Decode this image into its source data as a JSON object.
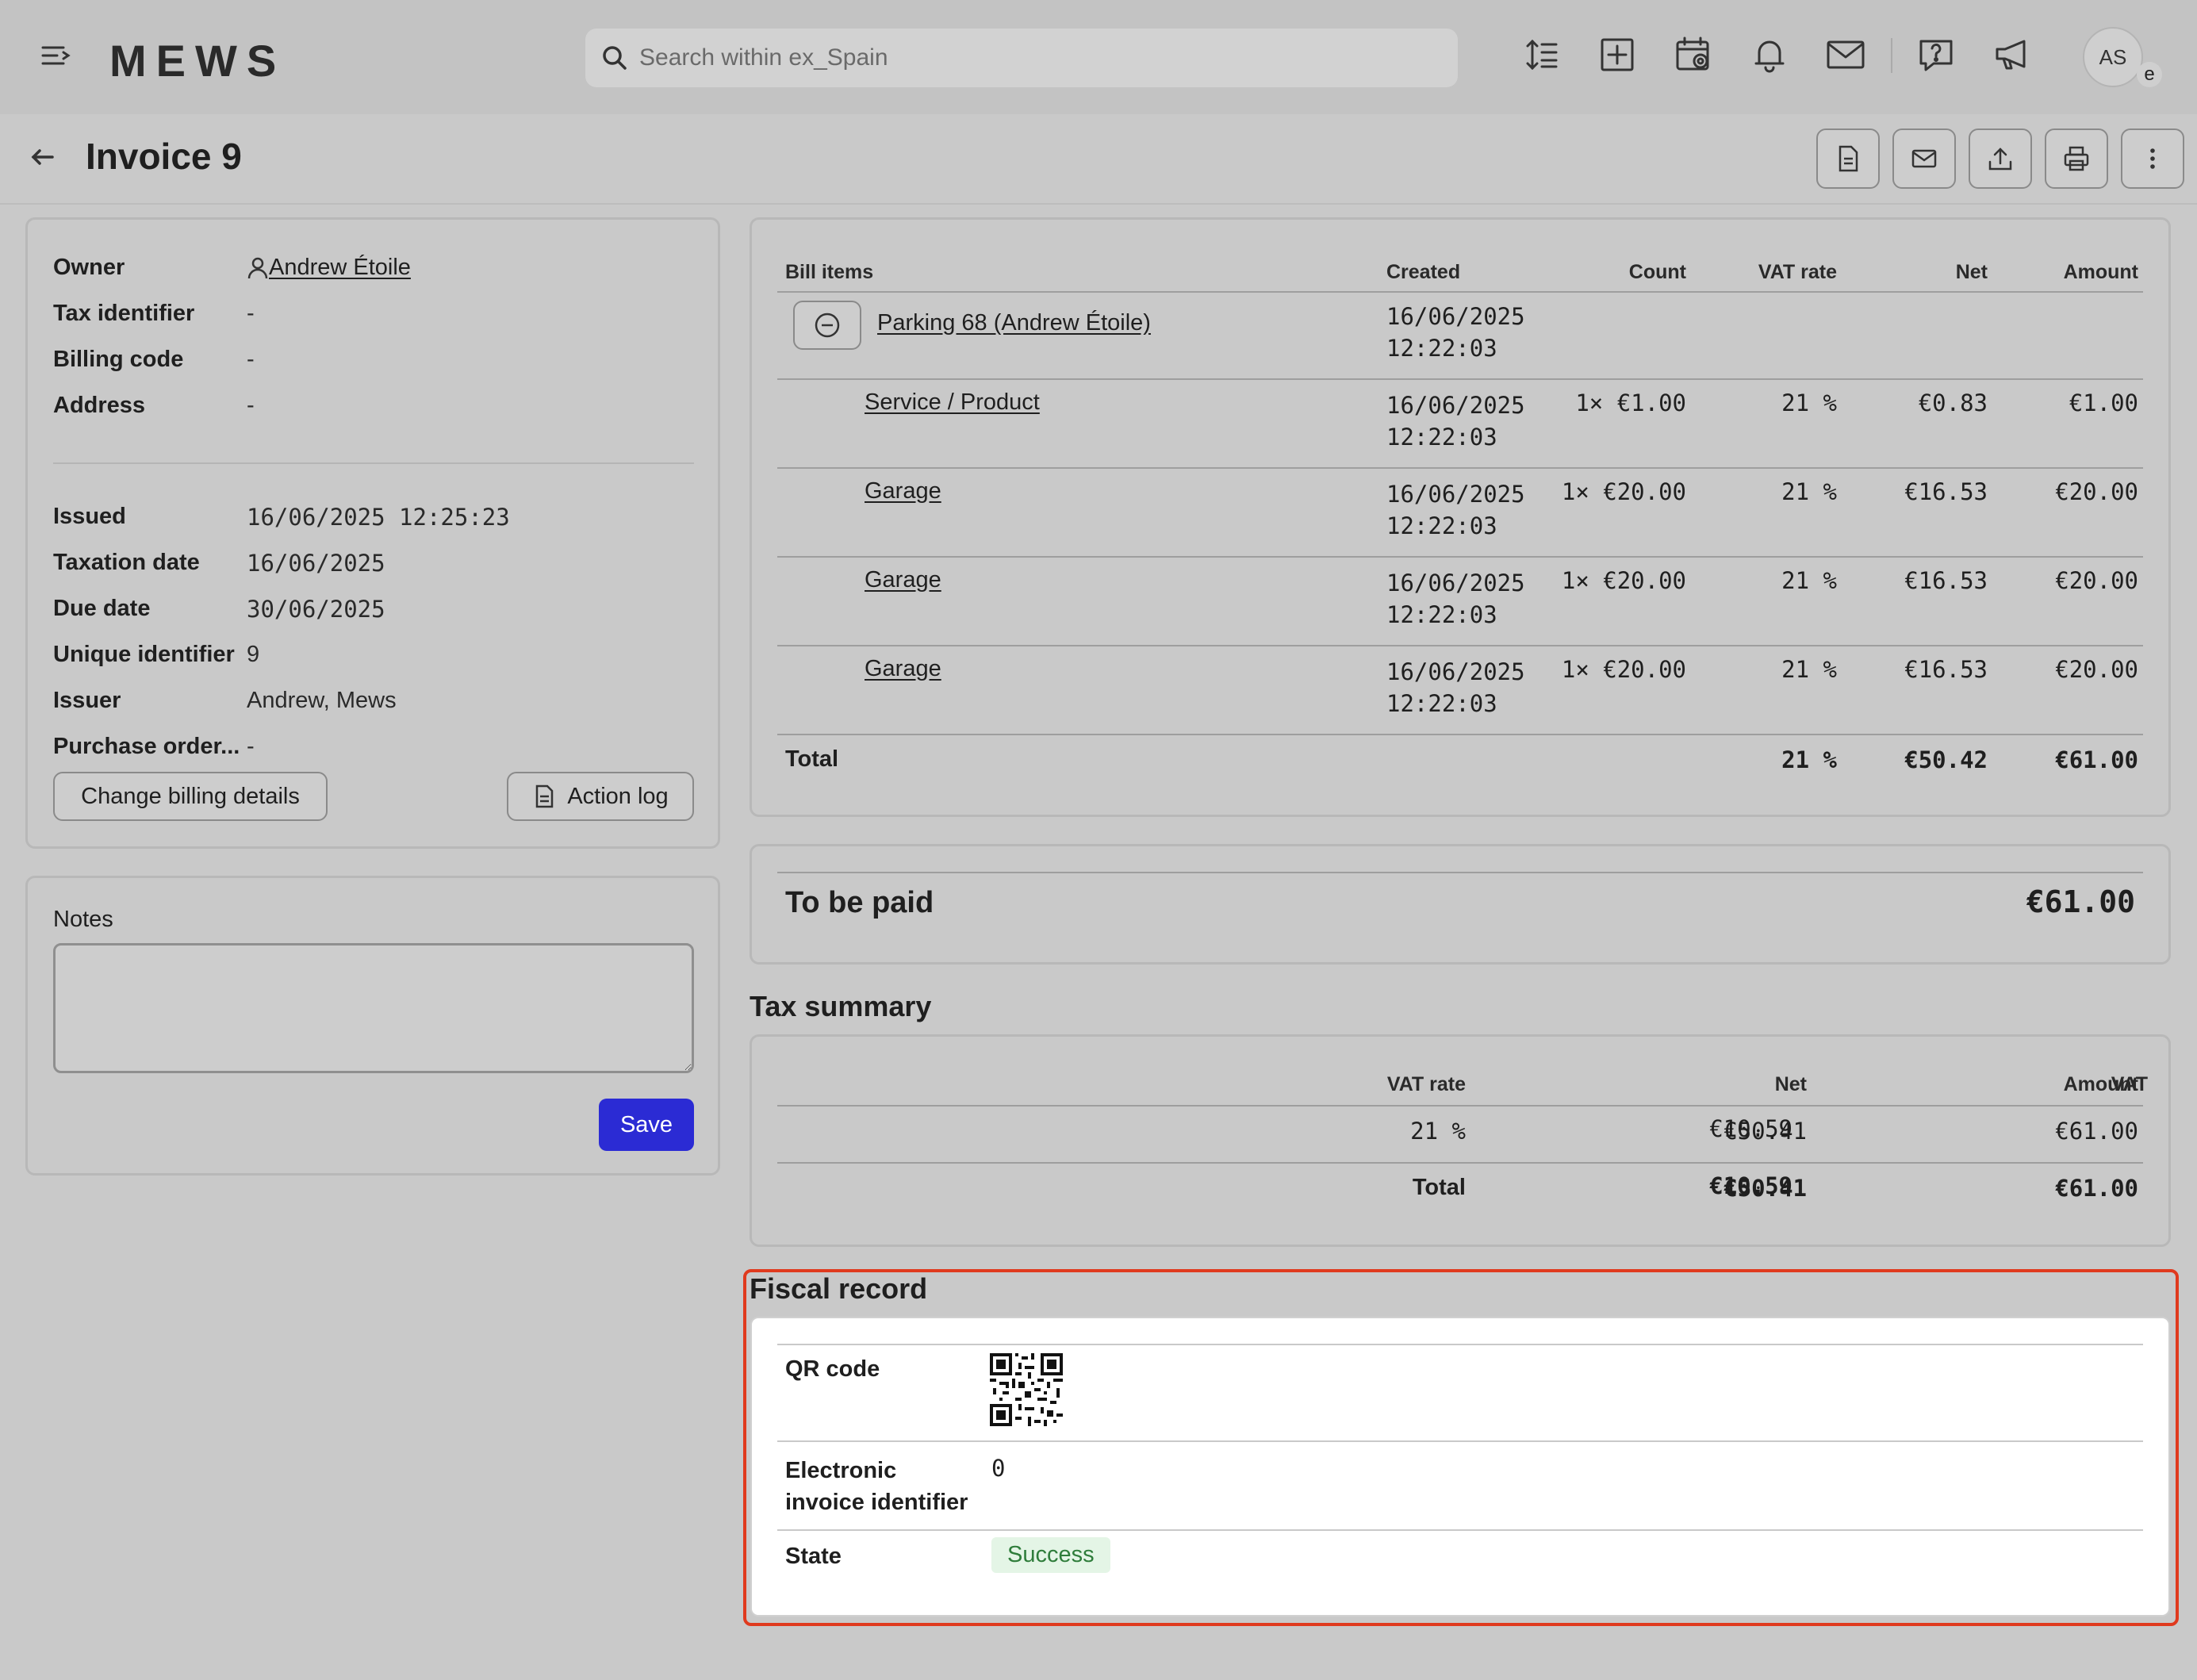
{
  "topbar": {
    "logo": "MEWS",
    "search_placeholder": "Search within ex_Spain",
    "avatar_initials": "AS",
    "avatar_badge": "e"
  },
  "header": {
    "title": "Invoice 9"
  },
  "details": {
    "owner_label": "Owner",
    "owner_value": " Andrew Étoile",
    "tax_identifier_label": "Tax identifier",
    "tax_identifier_value": "-",
    "billing_code_label": "Billing code",
    "billing_code_value": "-",
    "address_label": "Address",
    "address_value": "-",
    "issued_label": "Issued",
    "issued_value": "16/06/2025 12:25:23",
    "taxation_date_label": "Taxation date",
    "taxation_date_value": "16/06/2025",
    "due_date_label": "Due date",
    "due_date_value": "30/06/2025",
    "unique_identifier_label": "Unique identifier",
    "unique_identifier_value": "9",
    "issuer_label": "Issuer",
    "issuer_value": "Andrew, Mews",
    "purchase_order_label": "Purchase order...",
    "purchase_order_value": "-",
    "change_billing_label": "Change billing details",
    "action_log_label": "Action log"
  },
  "notes": {
    "label": "Notes",
    "value": "",
    "save_label": "Save"
  },
  "bill": {
    "headers": [
      "Bill items",
      "Created",
      "Count",
      "VAT rate",
      "Net",
      "Amount"
    ],
    "group": {
      "name": "Parking 68 (Andrew Étoile)",
      "date": "16/06/2025",
      "time": "12:22:03"
    },
    "rows": [
      {
        "name": "Service / Product",
        "date": "16/06/2025",
        "time": "12:22:03",
        "count": "1× €1.00",
        "vat": "21 %",
        "net": "€0.83",
        "amount": "€1.00"
      },
      {
        "name": "Garage",
        "date": "16/06/2025",
        "time": "12:22:03",
        "count": "1× €20.00",
        "vat": "21 %",
        "net": "€16.53",
        "amount": "€20.00"
      },
      {
        "name": "Garage",
        "date": "16/06/2025",
        "time": "12:22:03",
        "count": "1× €20.00",
        "vat": "21 %",
        "net": "€16.53",
        "amount": "€20.00"
      },
      {
        "name": "Garage",
        "date": "16/06/2025",
        "time": "12:22:03",
        "count": "1× €20.00",
        "vat": "21 %",
        "net": "€16.53",
        "amount": "€20.00"
      }
    ],
    "total": {
      "label": "Total",
      "vat": "21 %",
      "net": "€50.42",
      "amount": "€61.00"
    }
  },
  "to_be_paid": {
    "label": "To be paid",
    "value": "€61.00"
  },
  "tax_summary": {
    "title": "Tax summary",
    "headers": [
      "VAT rate",
      "Net",
      "VAT",
      "Amount"
    ],
    "row": {
      "vat_rate": "21 %",
      "net": "€50.41",
      "vat": "€10.59",
      "amount": "€61.00"
    },
    "total": {
      "label": "Total",
      "net": "€50.41",
      "vat": "€10.59",
      "amount": "€61.00"
    }
  },
  "fiscal": {
    "title": "Fiscal record",
    "qr_label": "QR code",
    "einvoice_label_1": "Electronic",
    "einvoice_label_2": "invoice identifier",
    "einvoice_value": "0",
    "state_label": "State",
    "state_value": "Success"
  },
  "colors": {
    "accent": "#2b2bd4",
    "highlight_outline": "#e03a1e",
    "success_bg": "#e4f5e6",
    "success_text": "#2f7d3b"
  }
}
